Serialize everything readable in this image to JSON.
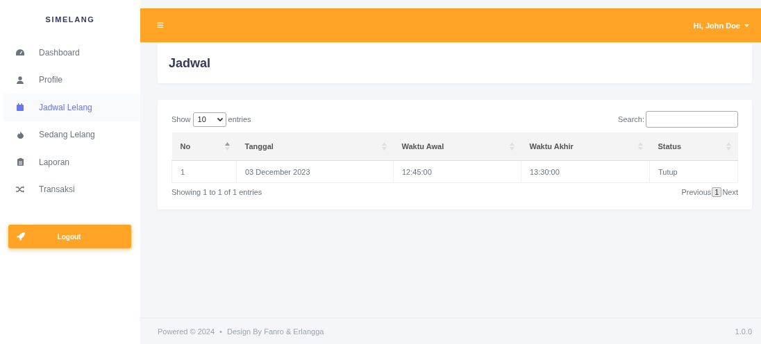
{
  "sidebar": {
    "brand": "SIMELANG",
    "items": [
      {
        "label": "Dashboard",
        "selected": false
      },
      {
        "label": "Profile",
        "selected": false
      },
      {
        "label": "Jadwal Lelang",
        "selected": true
      },
      {
        "label": "Sedang Lelang",
        "selected": false
      },
      {
        "label": "Laporan",
        "selected": false
      },
      {
        "label": "Transaksi",
        "selected": false
      }
    ],
    "logout": "Logout"
  },
  "topbar": {
    "menu_icon": "≡",
    "user": "Hi, John Doe"
  },
  "page": {
    "title": "Jadwal"
  },
  "table": {
    "length_label_before": "Show",
    "length_value": "10",
    "length_label_after": "entries",
    "search_label": "Search:",
    "columns": [
      {
        "label": "No",
        "sorted": true
      },
      {
        "label": "Tanggal",
        "sorted": false
      },
      {
        "label": "Waktu Awal",
        "sorted": false
      },
      {
        "label": "Waktu Akhir",
        "sorted": false
      },
      {
        "label": "Status",
        "sorted": false
      }
    ],
    "rows": [
      [
        "1",
        "03 December 2023",
        "12:45:00",
        "13:30:00",
        "Tutup"
      ]
    ],
    "info": "Showing 1 to 1 of 1 entries",
    "previous": "Previous",
    "pages": [
      {
        "label": "1",
        "selected": true
      }
    ],
    "next": "Next"
  },
  "footer": {
    "left": "Powered © 2024",
    "separator": "•",
    "credit": "Design By Fanro & Erlangga",
    "version": "1.0.0"
  }
}
